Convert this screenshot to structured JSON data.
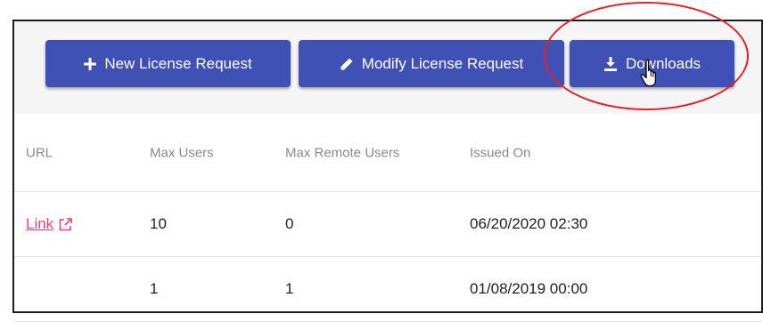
{
  "toolbar": {
    "new_label": "New License Request",
    "modify_label": "Modify License Request",
    "downloads_label": "Downloads"
  },
  "table": {
    "headers": [
      "URL",
      "Max Users",
      "Max Remote Users",
      "Issued On"
    ],
    "rows": [
      {
        "url": "Link",
        "max_users": "10",
        "max_remote_users": "0",
        "issued_on": "06/20/2020 02:30"
      },
      {
        "url": "",
        "max_users": "1",
        "max_remote_users": "1",
        "issued_on": "01/08/2019 00:00"
      }
    ]
  },
  "icons": {
    "new": "plus-icon",
    "modify": "pencil-icon",
    "downloads": "download-icon",
    "link": "external-link-icon",
    "cursor": "hand-pointer-icon"
  },
  "colors": {
    "button_bg": "#3f51b5",
    "button_text": "#ffffff",
    "link": "#e83e8c",
    "header_text": "#8a8a8a",
    "annotation": "#e8202a"
  }
}
